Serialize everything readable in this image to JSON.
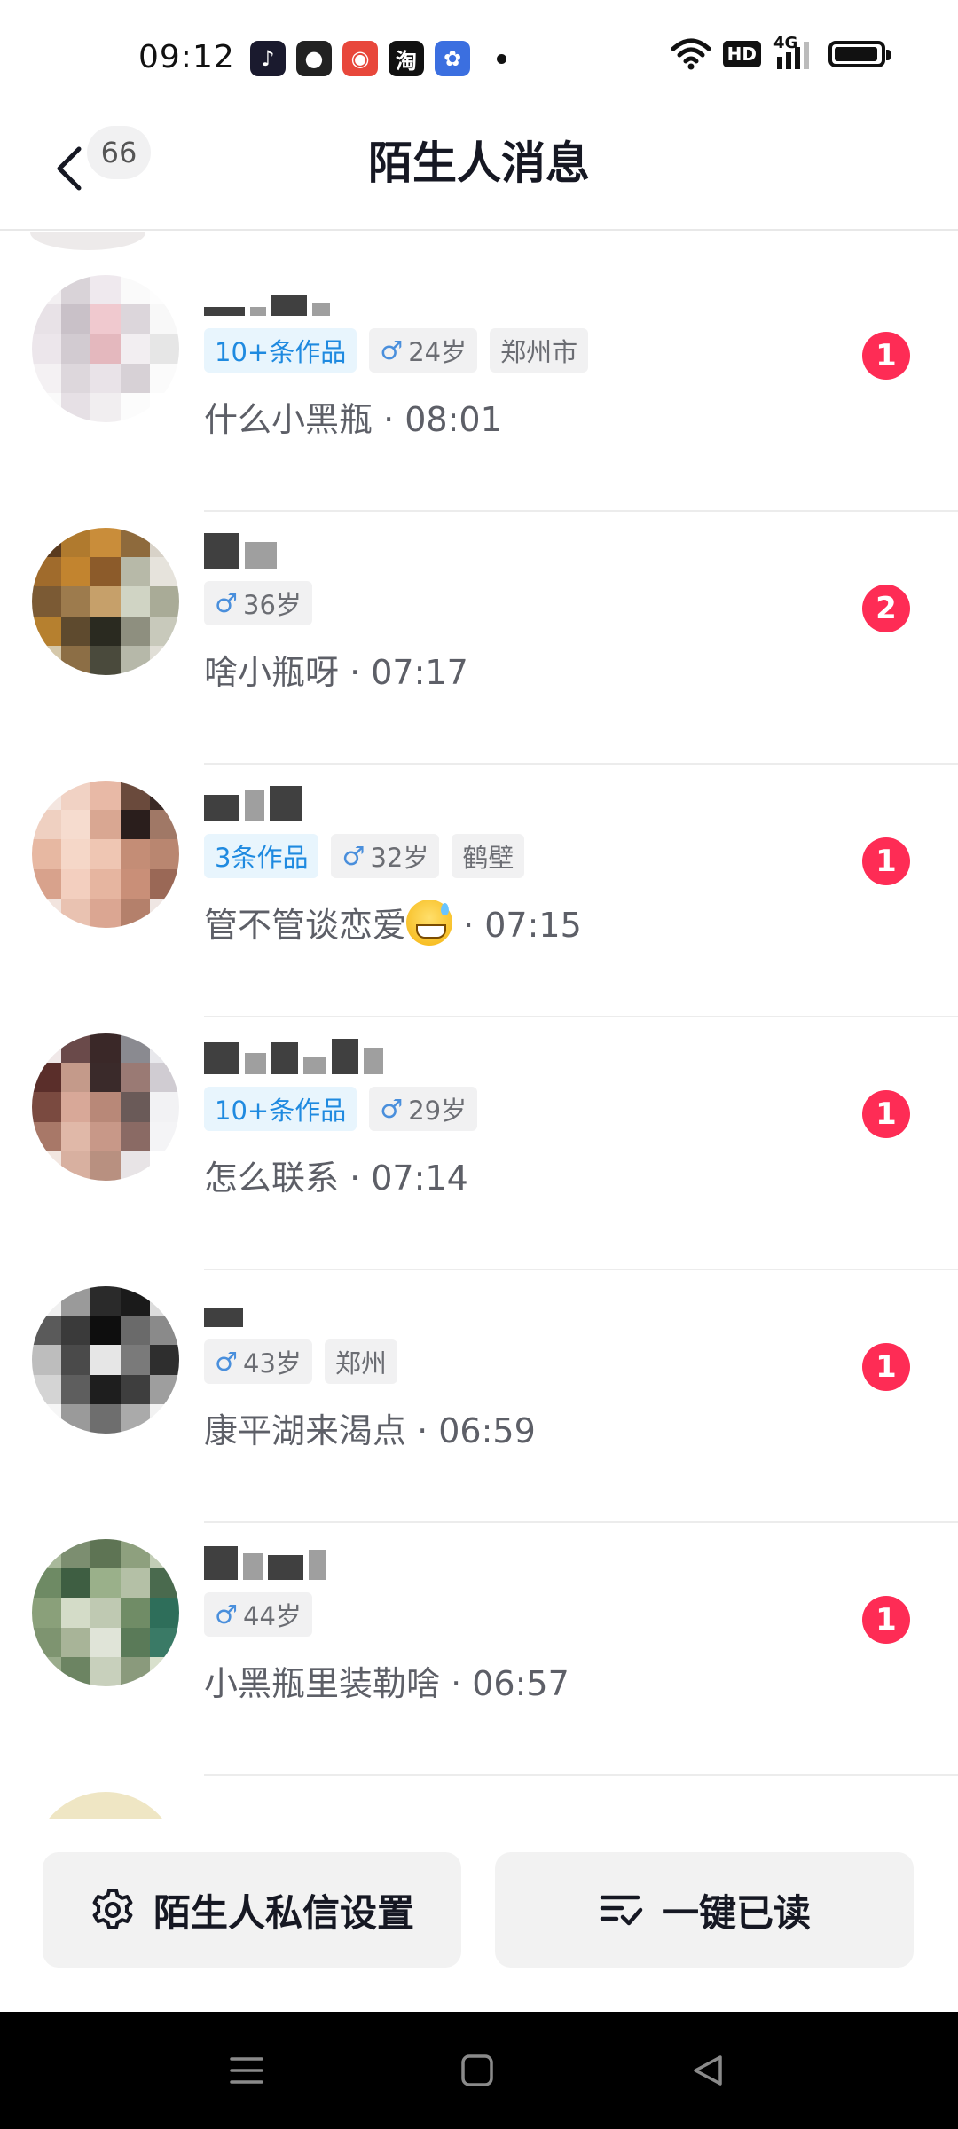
{
  "status_bar": {
    "time": "09:12",
    "apps": [
      {
        "icon": "douyin-icon",
        "glyph": "♪",
        "color": "#1a1a2e"
      },
      {
        "icon": "wechat-icon",
        "glyph": "●",
        "color": "#222222"
      },
      {
        "icon": "map-icon",
        "glyph": "◉",
        "color": "#e8473b"
      },
      {
        "icon": "taobao-icon",
        "glyph": "淘",
        "color": "#111111"
      },
      {
        "icon": "baidu-icon",
        "glyph": "✿",
        "color": "#3b6fe0"
      }
    ],
    "hd": "HD",
    "network": "4G",
    "battery_level": 0.95
  },
  "header": {
    "back_count": "66",
    "title": "陌生人消息"
  },
  "conversations": [
    {
      "tags": [
        {
          "text": "10+条作品",
          "type": "works"
        },
        {
          "text": "24岁",
          "type": "age"
        },
        {
          "text": "郑州市",
          "type": "city"
        }
      ],
      "preview": "什么小黑瓶 · 08:01",
      "unread": "1",
      "avatar_colors": [
        "#f3f0f2",
        "#d9d3d8",
        "#efe9ee",
        "#fafafa",
        "#fdfdfd",
        "#e8e2e7",
        "#c9c1c8",
        "#f0c9cf",
        "#dcd6db",
        "#f8f8f8",
        "#ece6eb",
        "#d2cbd1",
        "#e4b8be",
        "#f2eef1",
        "#e6e6e6",
        "#f4f1f3",
        "#ddd7dc",
        "#e9e3e8",
        "#d7d1d6",
        "#fbfbfb",
        "#fafafa",
        "#e6e0e5",
        "#f1eef0",
        "#fcfcfc",
        "#ffffff"
      ],
      "name_blocks": [
        [
          46,
          10
        ],
        [
          18,
          10
        ],
        [
          40,
          24
        ],
        [
          20,
          14
        ]
      ]
    },
    {
      "tags": [
        {
          "text": "36岁",
          "type": "age"
        }
      ],
      "preview": "啥小瓶呀 · 07:17",
      "unread": "2",
      "avatar_colors": [
        "#5a3a1e",
        "#b07a2e",
        "#c98d3a",
        "#8e6a3c",
        "#d8d2c8",
        "#a06b2c",
        "#c2842f",
        "#8c5b2a",
        "#b7b9a8",
        "#e6e3dc",
        "#7b5a34",
        "#9d7b4d",
        "#c6a06a",
        "#d0d4c4",
        "#a9ab97",
        "#b6802f",
        "#5e4a2e",
        "#2a2a20",
        "#8e8f7f",
        "#c8c9bb",
        "#d5c8aa",
        "#8c6e45",
        "#4a4a3c",
        "#b6b8a9",
        "#e0ded6"
      ],
      "name_blocks": [
        [
          40,
          40
        ],
        [
          36,
          30
        ]
      ]
    },
    {
      "tags": [
        {
          "text": "3条作品",
          "type": "works"
        },
        {
          "text": "32岁",
          "type": "age"
        },
        {
          "text": "鹤壁",
          "type": "city"
        }
      ],
      "preview": "管不管谈恋爱",
      "emoji": true,
      "time_suffix": " · 07:15",
      "unread": "1",
      "avatar_colors": [
        "#f4e6e0",
        "#f1d2c4",
        "#e8b9a6",
        "#6a4a3c",
        "#3a2a26",
        "#efd0c1",
        "#f6dccf",
        "#d9a792",
        "#2a1e1c",
        "#a07866",
        "#e7b8a2",
        "#f5d7c8",
        "#efc6b3",
        "#c48d76",
        "#b98670",
        "#d8a28c",
        "#f3cfbf",
        "#e6b5a0",
        "#c98f78",
        "#9a6856",
        "#f2e4de",
        "#e9c2b1",
        "#dba692",
        "#b4806b",
        "#efe6e3"
      ],
      "name_blocks": [
        [
          40,
          30
        ],
        [
          22,
          36
        ],
        [
          36,
          40
        ]
      ]
    },
    {
      "tags": [
        {
          "text": "10+条作品",
          "type": "works"
        },
        {
          "text": "29岁",
          "type": "age"
        }
      ],
      "preview": "怎么联系 · 07:14",
      "unread": "1",
      "avatar_colors": [
        "#f0e8e8",
        "#6a4a4a",
        "#3a2828",
        "#8a8a90",
        "#e8e8ec",
        "#5a2e2a",
        "#c49a8a",
        "#3a2a2a",
        "#9a7a74",
        "#d0ccd2",
        "#7a4a40",
        "#d8a898",
        "#b88878",
        "#6a5a58",
        "#f2f2f4",
        "#a87868",
        "#e0b8a8",
        "#c89888",
        "#8a6a64",
        "#f4f4f6",
        "#f2e6e0",
        "#d8b0a0",
        "#b89080",
        "#e8e4e6",
        "#ffffff"
      ],
      "name_blocks": [
        [
          40,
          36
        ],
        [
          24,
          24
        ],
        [
          30,
          36
        ],
        [
          26,
          20
        ],
        [
          30,
          40
        ],
        [
          22,
          30
        ]
      ]
    },
    {
      "tags": [
        {
          "text": "43岁",
          "type": "age"
        },
        {
          "text": "郑州",
          "type": "city"
        }
      ],
      "preview": "康平湖来渴点 · 06:59",
      "unread": "1",
      "avatar_colors": [
        "#f0f0f0",
        "#9a9a9a",
        "#2a2a2a",
        "#1a1a1a",
        "#dcdcdc",
        "#5a5a5a",
        "#3a3a3a",
        "#0e0e0e",
        "#6a6a6a",
        "#8a8a8a",
        "#bdbdbd",
        "#4a4a4a",
        "#e6e6e6",
        "#7a7a7a",
        "#2e2e2e",
        "#d4d4d4",
        "#5e5e5e",
        "#1e1e1e",
        "#3e3e3e",
        "#9e9e9e",
        "#f6f6f6",
        "#9a9a9a",
        "#6e6e6e",
        "#aaaaaa",
        "#f2f2f2"
      ],
      "name_blocks": [
        [
          44,
          22
        ]
      ]
    },
    {
      "tags": [
        {
          "text": "44岁",
          "type": "age"
        }
      ],
      "preview": "小黑瓶里装勒啥 · 06:57",
      "unread": "1",
      "avatar_colors": [
        "#a8b89a",
        "#7c8e70",
        "#5e7454",
        "#8ea07e",
        "#c2cdb6",
        "#6e8a64",
        "#3e5e42",
        "#9ab08a",
        "#b4c0a6",
        "#4a6a4e",
        "#8aa07a",
        "#d4dcc8",
        "#bfc9b2",
        "#708c66",
        "#2e6e5a",
        "#7e9470",
        "#a8b498",
        "#e0e4d8",
        "#5a7a58",
        "#3a7a66",
        "#9aac8c",
        "#6c8462",
        "#c8d0bc",
        "#8a9a7c",
        "#d8e0cc"
      ],
      "name_blocks": [
        [
          38,
          38
        ],
        [
          22,
          30
        ],
        [
          40,
          28
        ],
        [
          20,
          34
        ]
      ]
    }
  ],
  "bottom_actions": {
    "settings_label": "陌生人私信设置",
    "read_all_label": "一键已读"
  }
}
